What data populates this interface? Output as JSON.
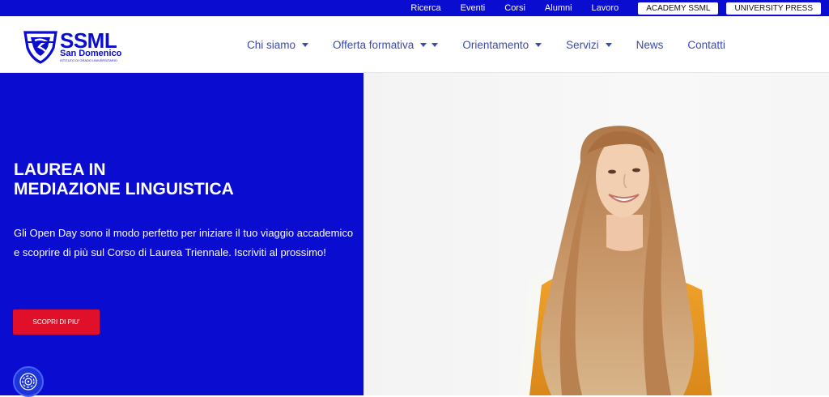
{
  "topbar": {
    "links": [
      "Ricerca",
      "Eventi",
      "Corsi",
      "Alumni",
      "Lavoro"
    ],
    "pills": [
      "ACADEMY SSML",
      "UNIVERSITY PRESS"
    ]
  },
  "logo": {
    "name": "SSML",
    "subtitle": "San Domenico",
    "tagline": "ISTITUTO DI GRADO UNIVERSITARIO",
    "icon": "shield-logo-icon"
  },
  "nav": {
    "items": [
      {
        "label": "Chi siamo",
        "dropdown": true
      },
      {
        "label": "Offerta formativa",
        "dropdown": true
      },
      {
        "label": "Orientamento",
        "dropdown": true
      },
      {
        "label": "Servizi",
        "dropdown": true
      },
      {
        "label": "News",
        "dropdown": false
      },
      {
        "label": "Contatti",
        "dropdown": false
      }
    ]
  },
  "hero": {
    "title_line1": "LAUREA IN",
    "title_line2": "MEDIAZIONE LINGUISTICA",
    "text": "Gli Open Day sono il modo perfetto per iniziare il tuo viaggio accademico e scoprire di più sul Corso di Laurea Triennale. Iscriviti al prossimo!",
    "cta_label": "SCOPRI DI PIU'",
    "image": "smiling-student-photo"
  },
  "widget": {
    "icon": "fingerprint-icon"
  },
  "colors": {
    "brand_blue": "#0a0ccf",
    "cta_red": "#e0102a",
    "nav_text": "#3a4bb0"
  }
}
